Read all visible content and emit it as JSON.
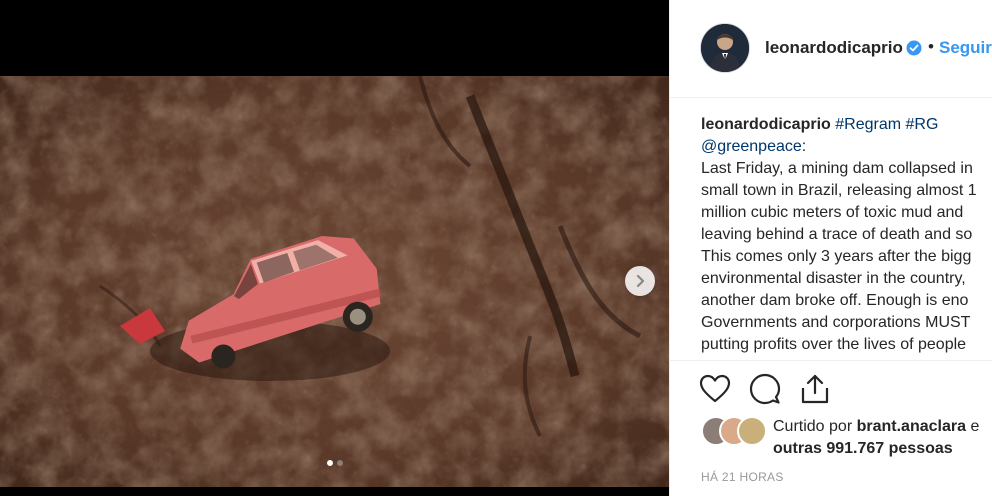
{
  "post": {
    "username": "leonardodicaprio",
    "separator": "•",
    "follow_label": "Seguir",
    "caption_username": "leonardodicaprio",
    "caption_tags": "#Regram #RG",
    "caption_mention": "@greenpeace",
    "caption_colon": ":",
    "caption_lines": [
      "Last Friday, a mining dam collapsed in",
      "small town in Brazil, releasing almost 1",
      "million cubic meters of toxic mud and",
      "leaving behind a trace of death and so",
      "This comes only 3 years after the bigg",
      "environmental disaster in the country,",
      "another dam broke off. Enough is eno",
      "Governments and corporations MUST",
      "putting profits over the lives of people"
    ],
    "likes_prefix": "Curtido por",
    "likes_user": "brant.anaclara",
    "likes_suffix": "e",
    "likes_others": "outras 991.767 pessoas",
    "timestamp": "HÁ 21 HORAS"
  },
  "icons": {
    "verified": "verified-badge-icon",
    "next": "chevron-right-icon",
    "like": "heart-icon",
    "comment": "comment-icon",
    "share": "share-icon"
  },
  "colors": {
    "accent": "#3897f0",
    "hashtag": "#003569",
    "text": "#262626",
    "muted": "#999999",
    "mud": "#5a3a2a",
    "car": "#d86a6a"
  }
}
